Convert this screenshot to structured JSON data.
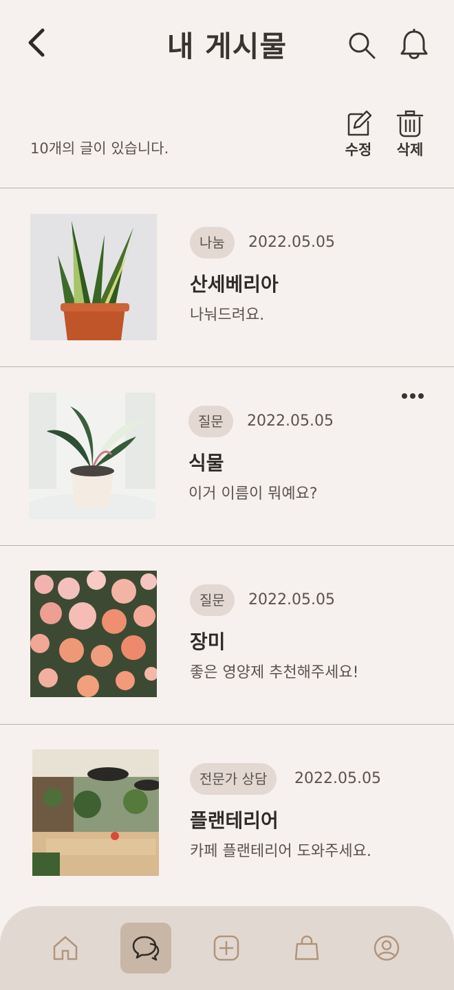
{
  "header": {
    "title": "내 게시물",
    "back_icon": "chevron-left-icon",
    "search_icon": "search-icon",
    "bell_icon": "bell-icon"
  },
  "summary": {
    "count_text": "10개의 글이 있습니다."
  },
  "actions": {
    "edit_label": "수정",
    "delete_label": "삭제"
  },
  "posts": [
    {
      "tag": "나눔",
      "date": "2022.05.05",
      "title": "산세베리아",
      "desc": "나눠드려요.",
      "image": "snake-plant-photo"
    },
    {
      "tag": "질문",
      "date": "2022.05.05",
      "title": "식물",
      "desc": "이거 이름이 뭐예요?",
      "image": "potted-plant-photo"
    },
    {
      "tag": "질문",
      "date": "2022.05.05",
      "title": "장미",
      "desc": "좋은 영양제 추천해주세요!",
      "image": "roses-photo"
    },
    {
      "tag": "전문가 상담",
      "date": "2022.05.05",
      "title": "플랜테리어",
      "desc": "카페 플랜테리어 도와주세요.",
      "image": "cafe-interior-photo"
    }
  ],
  "nav": {
    "items": [
      "home-icon",
      "chat-icon",
      "plus-icon",
      "shopping-bag-icon",
      "profile-icon"
    ],
    "active_index": 1
  },
  "colors": {
    "background": "#f6f1ee",
    "tag_bg": "#e3d8d2",
    "nav_bg": "#e2d8d2",
    "nav_active": "#c8b6a6",
    "nav_icon": "#b19478"
  }
}
